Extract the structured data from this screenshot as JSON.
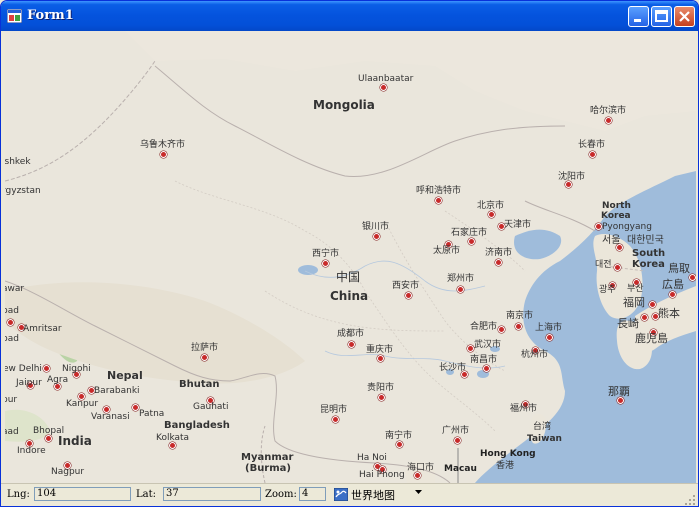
{
  "window": {
    "title": "Form1"
  },
  "statusbar": {
    "lng_label": "Lng:",
    "lng_value": "104",
    "lat_label": "Lat:",
    "lat_value": "37",
    "zoom_label": "Zoom:",
    "zoom_value": "4",
    "map_type": "世界地图"
  },
  "map": {
    "countries": {
      "mongolia": "Mongolia",
      "china_cn": "中国",
      "china": "China",
      "north_korea": "North Korea",
      "south_korea": "South Korea",
      "south_korea_cn": "대한민국",
      "nepal": "Nepal",
      "bhutan": "Bhutan",
      "bangladesh": "Bangladesh",
      "india": "India",
      "myanmar": "Myanmar",
      "burma": "(Burma)",
      "kyrgyzstan": "rgyzstan",
      "taiwan": "Taiwan",
      "macau": "Macau",
      "hong_kong": "Hong Kong"
    },
    "cities": {
      "ulaanbaatar": "Ulaanbaatar",
      "urumqi": "乌鲁木齐市",
      "harbin": "哈尔滨市",
      "changchun": "长春市",
      "shenyang": "沈阳市",
      "hohhot": "呼和浩特市",
      "beijing": "北京市",
      "tianjin": "天津市",
      "shijiazhuang": "石家庄市",
      "taiyuan": "太原市",
      "jinan": "济南市",
      "yinchuan": "银川市",
      "xining": "西宁市",
      "zhengzhou": "郑州市",
      "xian": "西安市",
      "nanjing": "南京市",
      "hefei": "合肥市",
      "shanghai": "上海市",
      "wuhan": "武汉市",
      "hangzhou": "杭州市",
      "chengdu": "成都市",
      "chongqing": "重庆市",
      "nanchang": "南昌市",
      "changsha": "长沙市",
      "lhasa": "拉萨市",
      "guiyang": "贵阳市",
      "fuzhou": "福州市",
      "kunming": "昆明市",
      "taipei": "台湾",
      "nanning": "南宁市",
      "guangzhou": "广州市",
      "hongkong_cn": "香港",
      "haikou": "海口市",
      "hanoi": "Ha Noi",
      "haiphong": "Hai Phong",
      "pyongyang": "Pyongyang",
      "seoul": "서울",
      "daejeon": "대전",
      "busan": "부산",
      "gwangju": "광주",
      "tottori": "鳥取",
      "hiroshima": "広島",
      "fukuoka": "福岡",
      "kumamoto": "熊本",
      "nagasaki": "長崎",
      "kagoshima": "鹿児島",
      "naha": "那覇",
      "bishkek": "ishkek",
      "amritsar": "Amritsar",
      "new_delhi": "ew Delhi",
      "nigohi": "Nigohi",
      "jaipur": "Jaipur",
      "agra": "Agra",
      "kanpur": "Kanpur",
      "barabanki": "Barabanki",
      "varanasi": "Varanasi",
      "patna": "Patna",
      "gauhati": "Gauhati",
      "kolkata": "Kolkata",
      "bhopal": "Bhopal",
      "indore": "Indore",
      "nagpur": "Nagpur",
      "hawar": "awar",
      "bad1": "bad",
      "bad2": "bad",
      "pur": "pur",
      "aad": "aad",
      "lhasa_en": "拉萨市"
    }
  }
}
